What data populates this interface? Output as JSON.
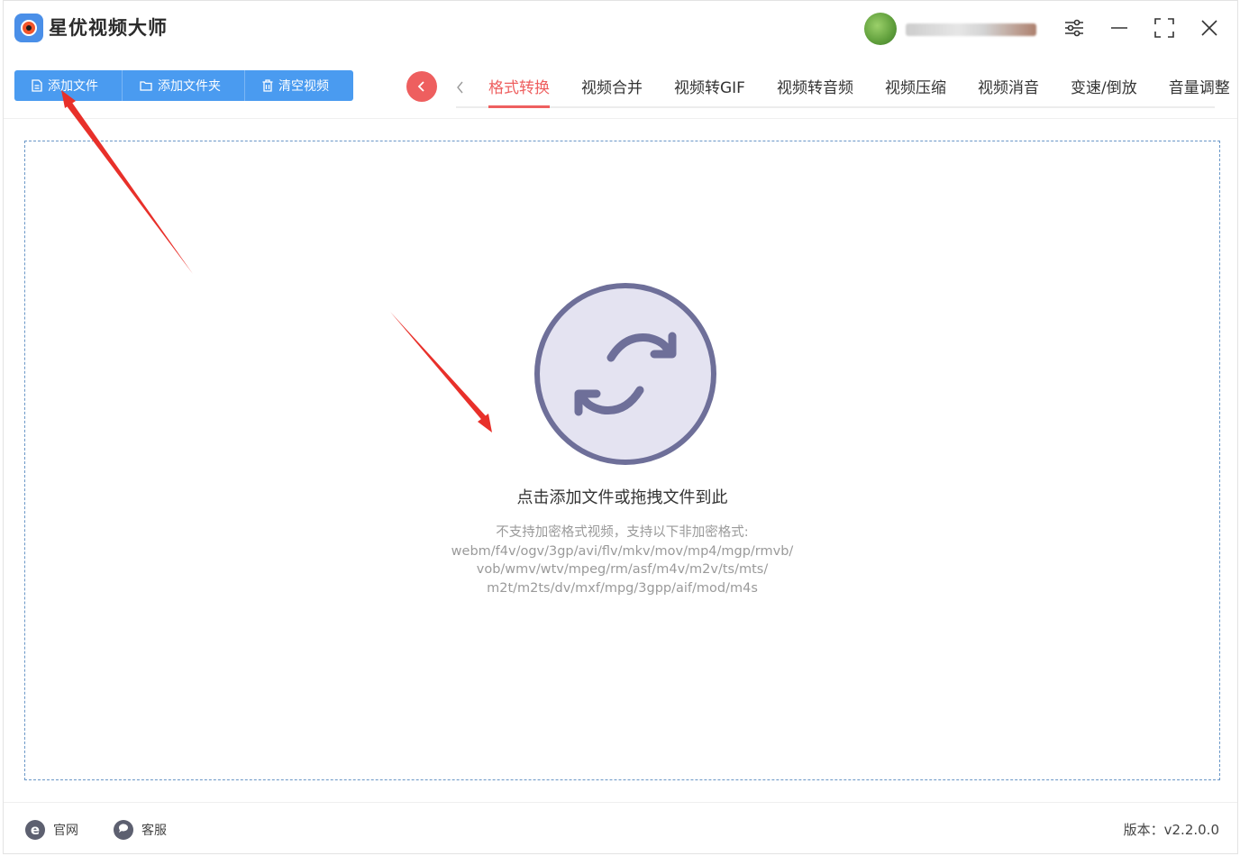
{
  "app": {
    "title": "星优视频大师"
  },
  "toolbar": {
    "add_file": "添加文件",
    "add_folder": "添加文件夹",
    "clear_videos": "清空视频"
  },
  "tabs": [
    {
      "label": "格式转换",
      "active": true
    },
    {
      "label": "视频合并"
    },
    {
      "label": "视频转GIF"
    },
    {
      "label": "视频转音频"
    },
    {
      "label": "视频压缩"
    },
    {
      "label": "视频消音"
    },
    {
      "label": "变速/倒放"
    },
    {
      "label": "音量调整"
    }
  ],
  "dropzone": {
    "title": "点击添加文件或拖拽文件到此",
    "formats_lines": [
      "不支持加密格式视频，支持以下非加密格式:",
      "webm/f4v/ogv/3gp/avi/flv/mkv/mov/mp4/mgp/rmvb/",
      "vob/wmv/wtv/mpeg/rm/asf/m4v/m2v/ts/mts/",
      "m2t/m2ts/dv/mxf/mpg/3gpp/aif/mod/m4s"
    ]
  },
  "footer": {
    "website": "官网",
    "support": "客服",
    "version": "版本：v2.2.0.0"
  },
  "colors": {
    "accent_blue": "#4a9bf0",
    "accent_red": "#ee5f5f",
    "icon_purple": "#6e6f99",
    "icon_fill": "#e4e3f1"
  }
}
